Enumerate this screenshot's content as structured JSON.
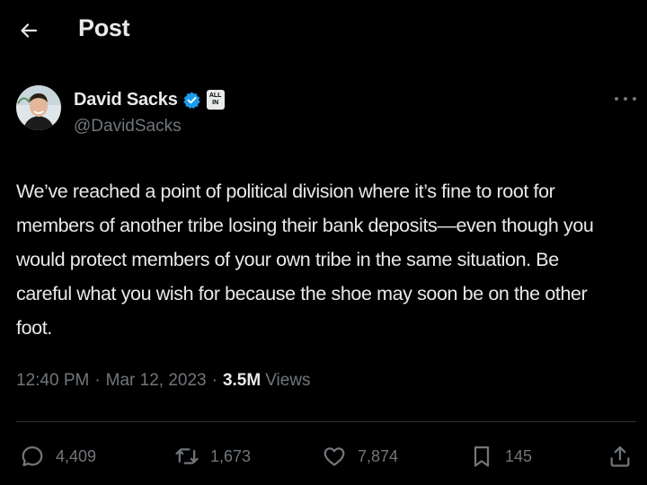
{
  "header": {
    "title": "Post",
    "back_icon": "arrow-left-icon"
  },
  "author": {
    "display_name": "David Sacks",
    "handle": "@DavidSacks",
    "verified_icon": "verified-badge-icon",
    "verified_color": "#1d9bf0",
    "affiliate_badge": {
      "line1": "ALL",
      "line2": "IN"
    }
  },
  "tweet": {
    "text": "We’ve reached a point of political division where it’s fine to root for\nmembers of another tribe losing their bank deposits—even though you\nwould protect members of your own tribe in the same situation. Be\ncareful what you wish for because the shoe may soon be on the other\nfoot.",
    "time": "12:40 PM",
    "separator": "·",
    "date": "Mar 12, 2023",
    "views_count": "3.5M",
    "views_label": "Views"
  },
  "actions": {
    "replies": {
      "icon": "reply-icon",
      "count": "4,409"
    },
    "reposts": {
      "icon": "repost-icon",
      "count": "1,673"
    },
    "likes": {
      "icon": "heart-icon",
      "count": "7,874"
    },
    "bookmarks": {
      "icon": "bookmark-icon",
      "count": "145"
    },
    "share": {
      "icon": "share-icon"
    }
  },
  "colors": {
    "background": "#000000",
    "primary_text": "#e7e9ea",
    "secondary_text": "#71767b",
    "divider": "#2f3336"
  }
}
